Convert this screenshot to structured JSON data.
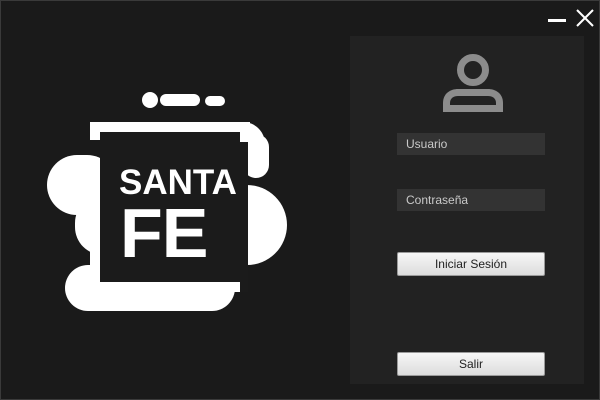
{
  "window": {
    "controls": {
      "minimize_icon": "minimize-icon",
      "close_icon": "close-icon"
    }
  },
  "logo": {
    "line1": "SANTA",
    "line2": "FE"
  },
  "login": {
    "avatar_icon": "user-avatar-icon",
    "username_placeholder": "Usuario",
    "password_placeholder": "Contraseña",
    "login_button": "Iniciar Sesión",
    "exit_button": "Salir"
  },
  "colors": {
    "background": "#1a1a1a",
    "panel": "#222222",
    "field": "#333333",
    "icon": "#8c8c8c",
    "logo": "#ffffff"
  }
}
